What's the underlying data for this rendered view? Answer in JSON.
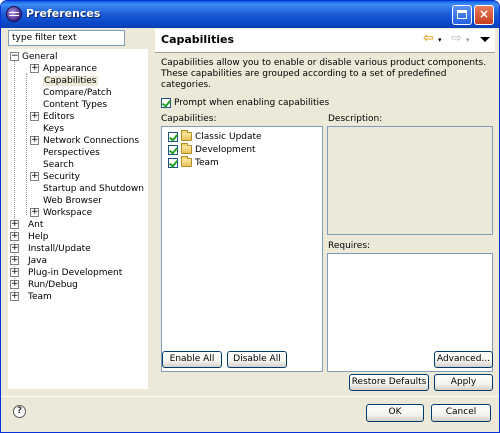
{
  "window": {
    "title": "Preferences",
    "maximize_label": "",
    "close_label": "×"
  },
  "filter": {
    "value": "type filter text"
  },
  "tree": [
    {
      "label": "General",
      "expander": "−"
    },
    {
      "label": "Appearance",
      "expander": "+"
    },
    {
      "label": "Capabilities",
      "expander": ""
    },
    {
      "label": "Compare/Patch",
      "expander": ""
    },
    {
      "label": "Content Types",
      "expander": ""
    },
    {
      "label": "Editors",
      "expander": "+"
    },
    {
      "label": "Keys",
      "expander": ""
    },
    {
      "label": "Network Connections",
      "expander": "+"
    },
    {
      "label": "Perspectives",
      "expander": ""
    },
    {
      "label": "Search",
      "expander": ""
    },
    {
      "label": "Security",
      "expander": "+"
    },
    {
      "label": "Startup and Shutdown",
      "expander": ""
    },
    {
      "label": "Web Browser",
      "expander": ""
    },
    {
      "label": "Workspace",
      "expander": "+"
    },
    {
      "label": "Ant",
      "expander": "+"
    },
    {
      "label": "Help",
      "expander": "+"
    },
    {
      "label": "Install/Update",
      "expander": "+"
    },
    {
      "label": "Java",
      "expander": "+"
    },
    {
      "label": "Plug-in Development",
      "expander": "+"
    },
    {
      "label": "Run/Debug",
      "expander": "+"
    },
    {
      "label": "Team",
      "expander": "+"
    }
  ],
  "page": {
    "title": "Capabilities",
    "back_icon": "back-arrow-icon",
    "forward_icon": "forward-arrow-icon",
    "description": "Capabilities allow you to enable or disable various product components.  These capabilities are grouped according to a set of predefined categories.",
    "prompt_label": "Prompt when enabling capabilities",
    "prompt_checked": true,
    "capabilities_label": "Capabilities:",
    "description_label": "Description:",
    "requires_label": "Requires:",
    "capabilities": [
      {
        "label": "Classic Update",
        "checked": true
      },
      {
        "label": "Development",
        "checked": true
      },
      {
        "label": "Team",
        "checked": true
      }
    ],
    "enable_all": "Enable All",
    "disable_all": "Disable All",
    "advanced": "Advanced...",
    "restore_defaults": "Restore Defaults",
    "apply": "Apply"
  },
  "footer": {
    "help": "?",
    "ok": "OK",
    "cancel": "Cancel"
  },
  "colors": {
    "titlebar": "#0a49c9",
    "dialog_bg": "#ece9d8",
    "field_border": "#7f9db9",
    "check_mark": "#21a121"
  }
}
